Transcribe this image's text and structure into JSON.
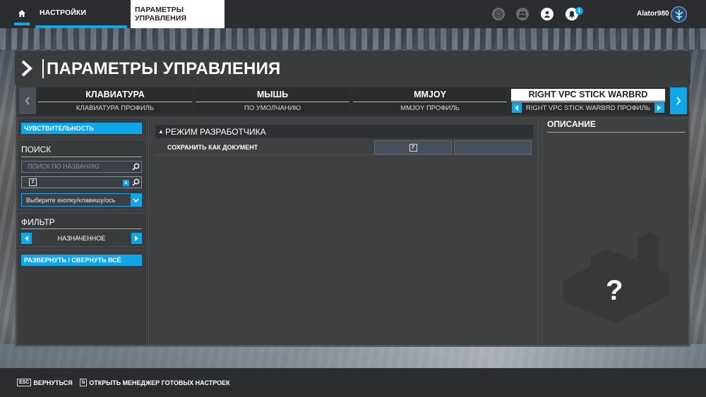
{
  "topbar": {
    "tabs": [
      {
        "label": "НАСТРОЙКИ"
      },
      {
        "label": "ПАРАМЕТРЫ УПРАВЛЕНИЯ"
      }
    ],
    "notification_count": "1",
    "username": "Alator980",
    "icons": [
      "home-icon",
      "target-icon",
      "friends-icon",
      "profile-icon",
      "bell-icon",
      "avatar-icon"
    ]
  },
  "page": {
    "title": "ПАРАМЕТРЫ УПРАВЛЕНИЯ"
  },
  "devices": [
    {
      "name": "КЛАВИАТУРА",
      "profile": "КЛАВИАТУРА ПРОФИЛЬ"
    },
    {
      "name": "МЫШЬ",
      "profile": "ПО УМОЛЧАНИЮ"
    },
    {
      "name": "MMJOY",
      "profile": "MMJOY ПРОФИЛЬ"
    },
    {
      "name": "RIGHT VPC STICK WARBRD",
      "profile": "RIGHT VPC STICK WARBRD ПРОФИЛЬ",
      "active": true
    }
  ],
  "left_panel": {
    "sensitivity_label": "ЧУВСТВИТЕЛЬНОСТЬ",
    "search_title": "ПОИСК",
    "search_placeholder": "ПОИСК ПО НАЗВАНИЮ",
    "key_search_value": "7",
    "key_clear": "x",
    "key_select_label": "Выберите кнопку/клавишу/ось",
    "filter_title": "ФИЛЬТР",
    "filter_value": "НАЗНАЧЕННОЕ",
    "expand_collapse_label": "РАЗВЕРНУТЬ / СВЕРНУТЬ ВСЁ"
  },
  "center_panel": {
    "section_title": "РЕЖИМ РАЗРАБОТЧИКА",
    "rows": [
      {
        "label": "СОХРАНИТЬ КАК ДОКУМЕНТ",
        "binding_1": "7",
        "binding_2": ""
      }
    ]
  },
  "right_panel": {
    "title": "ОПИСАНИЕ",
    "question_mark": "?"
  },
  "bottombar": {
    "back_key": "ESC",
    "back_label": "ВЕРНУТЬСЯ",
    "presets_key": "b",
    "presets_label": "ОТКРЫТЬ МЕНЕДЖЕР ГОТОВЫХ НАСТРОЕК"
  },
  "colors": {
    "accent": "#0fa7e8",
    "panel": "#3f4042",
    "topbar": "#2c2d30"
  }
}
